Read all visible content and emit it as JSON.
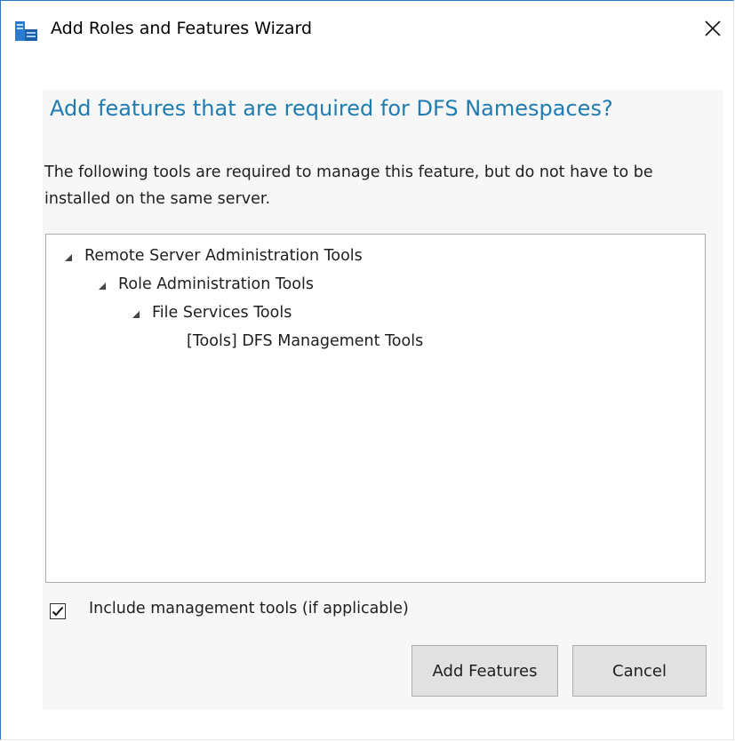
{
  "window": {
    "title": "Add Roles and Features Wizard"
  },
  "dialog": {
    "heading": "Add features that are required for DFS Namespaces?",
    "description": "The following tools are required to manage this feature, but do not have to be installed on the same server.",
    "tree": [
      {
        "label": "Remote Server Administration Tools",
        "level": 0,
        "expanded": true
      },
      {
        "label": "Role Administration Tools",
        "level": 1,
        "expanded": true
      },
      {
        "label": "File Services Tools",
        "level": 2,
        "expanded": true
      },
      {
        "label": "[Tools] DFS Management Tools",
        "level": 3,
        "expanded": false
      }
    ],
    "include_tools": {
      "label": "Include management tools (if applicable)",
      "checked": true
    },
    "buttons": {
      "add_label": "Add Features",
      "cancel_label": "Cancel"
    }
  },
  "colors": {
    "heading": "#1f7cb0",
    "panel": "#f7f7f7",
    "button": "#e1e1e1",
    "window_border": "#2b78c4"
  },
  "icons": {
    "app": "server-manager-icon",
    "close": "close-icon",
    "expand": "expanded-triangle-icon",
    "check": "checkmark-icon"
  }
}
